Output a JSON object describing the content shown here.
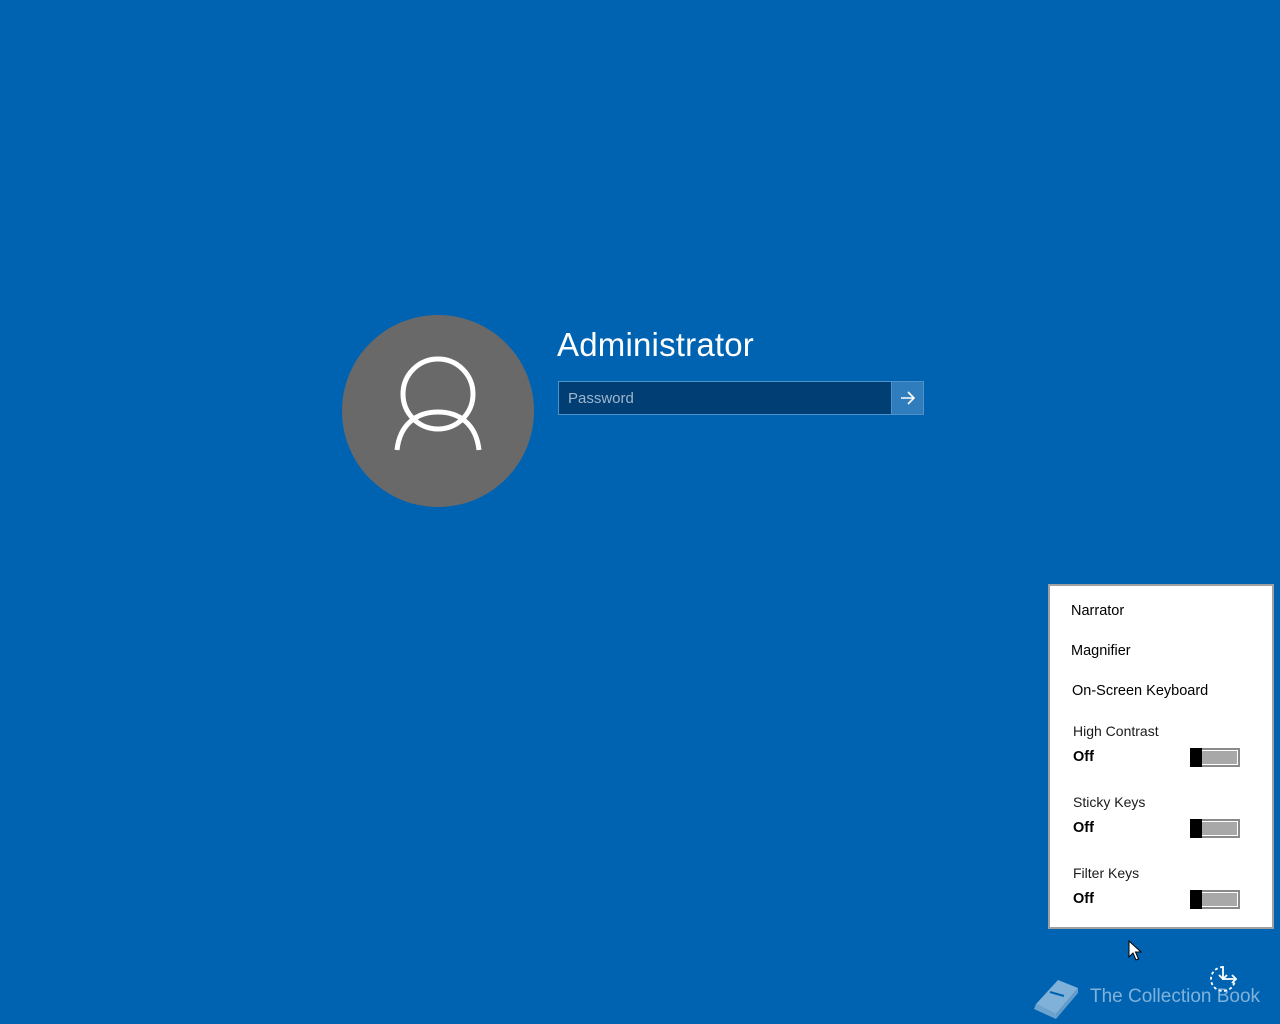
{
  "login": {
    "username": "Administrator",
    "password_placeholder": "Password",
    "password_value": ""
  },
  "ease_menu": {
    "items": [
      {
        "label": "Narrator"
      },
      {
        "label": "Magnifier"
      },
      {
        "label": "On-Screen Keyboard"
      }
    ],
    "toggles": [
      {
        "label": "High Contrast",
        "state": "Off"
      },
      {
        "label": "Sticky Keys",
        "state": "Off"
      },
      {
        "label": "Filter Keys",
        "state": "Off"
      }
    ]
  },
  "watermark": {
    "text": "The Collection Book"
  },
  "icons": {
    "avatar": "user-silhouette-icon",
    "submit": "arrow-right-icon",
    "ease": "ease-of-access-icon",
    "watermark": "book-icon"
  },
  "colors": {
    "background": "#0063b1",
    "avatar": "#696969",
    "password_field": "#003e74",
    "submit_button": "#2f7dbd"
  }
}
